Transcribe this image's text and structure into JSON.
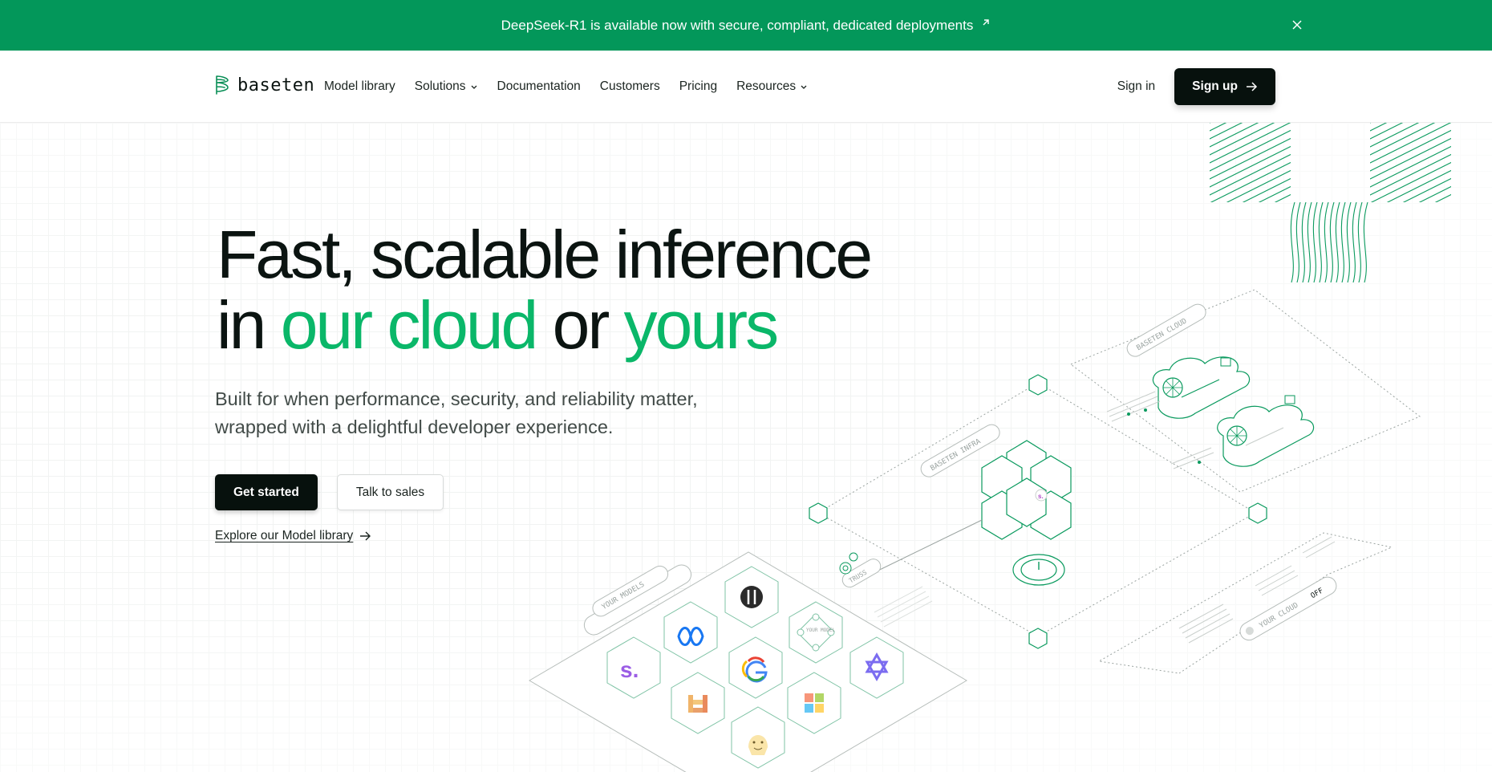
{
  "banner": {
    "text": "DeepSeek-R1 is available now with secure, compliant, dedicated deployments",
    "external_icon": "arrow-up-right-icon",
    "close_icon": "close-icon",
    "background": "#03975a"
  },
  "nav": {
    "logo_text": "baseten",
    "links": [
      {
        "label": "Model library",
        "dropdown": false
      },
      {
        "label": "Solutions",
        "dropdown": true
      },
      {
        "label": "Documentation",
        "dropdown": false
      },
      {
        "label": "Customers",
        "dropdown": false
      },
      {
        "label": "Pricing",
        "dropdown": false
      },
      {
        "label": "Resources",
        "dropdown": true
      }
    ],
    "signin_label": "Sign in",
    "signup_label": "Sign up"
  },
  "hero": {
    "headline": {
      "line1": "Fast, scalable inference",
      "line2_prefix": "in ",
      "line2_green1": "our cloud",
      "line2_middle": " or ",
      "line2_green2": "yours"
    },
    "subtitle": "Built for when performance, security, and reliability matter, wrapped with a delightful developer experience.",
    "primary_cta": "Get started",
    "secondary_cta": "Talk to sales",
    "explore_link": "Explore our Model library",
    "accent_color": "#0ab769"
  },
  "illustration": {
    "labels": {
      "baseten_cloud": "BASETEN CLOUD",
      "baseten_infra": "BASETEN INFRA",
      "your_models": "YOUR MODELS",
      "your_cloud": "YOUR CLOUD",
      "off": "OFF",
      "truss": "TRUSS",
      "your_model": "YOUR MODEL",
      "s_badge": "s."
    }
  }
}
